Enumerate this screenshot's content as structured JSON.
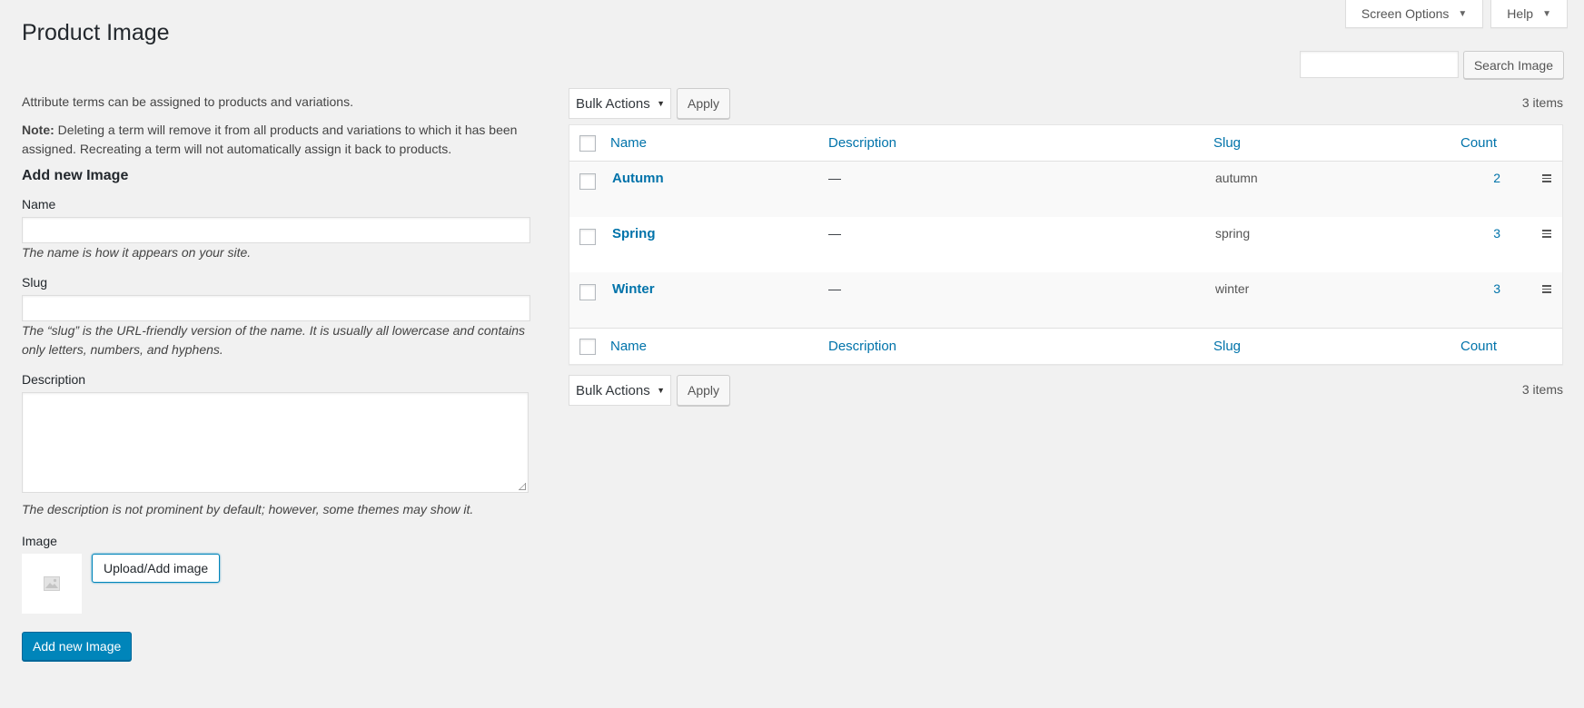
{
  "screen_meta": {
    "screen_options": "Screen Options",
    "help": "Help"
  },
  "page": {
    "title": "Product Image"
  },
  "search": {
    "placeholder": "",
    "button": "Search Image"
  },
  "form": {
    "intro": "Attribute terms can be assigned to products and variations.",
    "note_label": "Note:",
    "note_text": "Deleting a term will remove it from all products and variations to which it has been assigned. Recreating a term will not automatically assign it back to products.",
    "heading": "Add new Image",
    "name_label": "Name",
    "name_value": "",
    "name_hint": "The name is how it appears on your site.",
    "slug_label": "Slug",
    "slug_value": "",
    "slug_hint": "The “slug” is the URL-friendly version of the name. It is usually all lowercase and contains only letters, numbers, and hyphens.",
    "description_label": "Description",
    "description_value": "",
    "description_hint": "The description is not prominent by default; however, some themes may show it.",
    "image_label": "Image",
    "upload_button": "Upload/Add image",
    "submit_button": "Add new Image"
  },
  "tablenav": {
    "bulk_actions": "Bulk Actions",
    "apply": "Apply",
    "count": "3 items"
  },
  "table": {
    "columns": {
      "name": "Name",
      "description": "Description",
      "slug": "Slug",
      "count": "Count"
    },
    "rows": [
      {
        "name": "Autumn",
        "description": "—",
        "slug": "autumn",
        "count": "2"
      },
      {
        "name": "Spring",
        "description": "—",
        "slug": "spring",
        "count": "3"
      },
      {
        "name": "Winter",
        "description": "—",
        "slug": "winter",
        "count": "3"
      }
    ]
  }
}
